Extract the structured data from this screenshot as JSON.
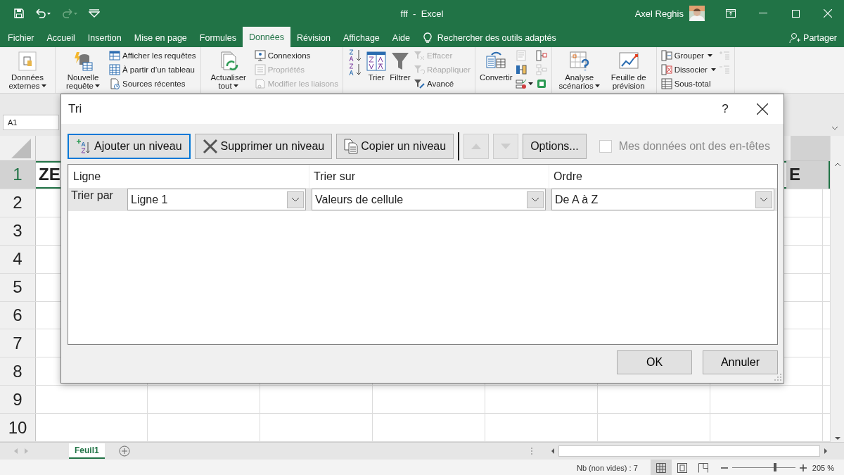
{
  "title_bar": {
    "title": "fff  -  Excel",
    "user": "Axel Reghis"
  },
  "menu_tabs": [
    {
      "label": "Fichier",
      "selected": false
    },
    {
      "label": "Accueil",
      "selected": false
    },
    {
      "label": "Insertion",
      "selected": false
    },
    {
      "label": "Mise en page",
      "selected": false
    },
    {
      "label": "Formules",
      "selected": false
    },
    {
      "label": "Données",
      "selected": true
    },
    {
      "label": "Révision",
      "selected": false
    },
    {
      "label": "Affichage",
      "selected": false
    },
    {
      "label": "Aide",
      "selected": false
    }
  ],
  "tell_me": "Rechercher des outils adaptés",
  "share": "Partager",
  "ribbon": {
    "groups": [
      {
        "columns": [
          [
            {
              "kind": "large",
              "label": "Données externes",
              "dropdown": true
            }
          ]
        ]
      },
      {
        "columns": [
          [
            {
              "kind": "large",
              "label": "Nouvelle requête",
              "dropdown": true
            }
          ],
          [
            {
              "kind": "small",
              "label": "Afficher les requêtes",
              "disabled": false
            },
            {
              "kind": "small",
              "label": "À partir d’un tableau",
              "disabled": false
            },
            {
              "kind": "small",
              "label": "Sources récentes",
              "disabled": false
            }
          ]
        ]
      },
      {
        "columns": [
          [
            {
              "kind": "large",
              "label": "Actualiser tout",
              "dropdown": true
            }
          ],
          [
            {
              "kind": "small",
              "label": "Connexions",
              "disabled": false
            },
            {
              "kind": "small",
              "label": "Propriétés",
              "disabled": true
            },
            {
              "kind": "small",
              "label": "Modifier les liaisons",
              "disabled": true
            }
          ]
        ]
      },
      {
        "columns": [
          [
            {
              "kind": "icon",
              "disabled": false
            },
            {
              "kind": "icon",
              "disabled": false
            }
          ],
          [
            {
              "kind": "large",
              "label": "Trier",
              "dropdown": false
            }
          ],
          [
            {
              "kind": "large",
              "label": "Filtrer",
              "dropdown": false
            }
          ],
          [
            {
              "kind": "small",
              "label": "Effacer",
              "disabled": true
            },
            {
              "kind": "small",
              "label": "Réappliquer",
              "disabled": true
            },
            {
              "kind": "small",
              "label": "Avancé",
              "disabled": false
            }
          ]
        ]
      },
      {
        "columns": [
          [
            {
              "kind": "large",
              "label": "Convertir",
              "dropdown": false
            }
          ],
          [
            {
              "kind": "icon",
              "disabled": true
            },
            {
              "kind": "icon",
              "disabled": false
            },
            {
              "kind": "icon",
              "disabled": false
            }
          ],
          [
            {
              "kind": "icon",
              "disabled": false
            },
            {
              "kind": "icon",
              "disabled": true
            },
            {
              "kind": "icon",
              "disabled": false
            }
          ]
        ]
      },
      {
        "columns": [
          [
            {
              "kind": "large",
              "label": "Analyse scénarios",
              "dropdown": true
            }
          ],
          [
            {
              "kind": "large",
              "label": "Feuille de prévision",
              "dropdown": false
            }
          ]
        ]
      },
      {
        "columns": [
          [
            {
              "kind": "small",
              "label": "Grouper",
              "disabled": false
            },
            {
              "kind": "small",
              "label": "Dissocier",
              "disabled": false
            },
            {
              "kind": "small",
              "label": "Sous-total",
              "disabled": false
            }
          ],
          [
            {
              "kind": "icon",
              "disabled": true
            },
            {
              "kind": "icon",
              "disabled": true
            }
          ]
        ]
      }
    ]
  },
  "name_box": "A1",
  "rows": [
    {
      "label": "1",
      "selected": true,
      "cells": [
        "ZE",
        "E"
      ]
    },
    {
      "label": "2",
      "selected": false
    },
    {
      "label": "3",
      "selected": false
    },
    {
      "label": "4",
      "selected": false
    },
    {
      "label": "5",
      "selected": false
    },
    {
      "label": "6",
      "selected": false
    },
    {
      "label": "7",
      "selected": false
    },
    {
      "label": "8",
      "selected": false
    },
    {
      "label": "9",
      "selected": false
    },
    {
      "label": "10",
      "selected": false
    }
  ],
  "sheet_tabs": [
    {
      "label": "Feuil1",
      "selected": true
    }
  ],
  "status_bar": {
    "summary": "Nb (non vides) : 7",
    "views": [
      {
        "selected": true
      },
      {
        "selected": false
      },
      {
        "selected": false
      }
    ],
    "zoom": {
      "level": 0.68,
      "reading": "205 %"
    }
  },
  "sort_dialog": {
    "title": "Tri",
    "help": "?",
    "toolbar": [
      {
        "kind": "add",
        "label": "Ajouter un niveau",
        "focused": true
      },
      {
        "kind": "delete",
        "label": "Supprimer un niveau",
        "focused": false
      },
      {
        "kind": "copy",
        "label": "Copier un niveau",
        "focused": false
      },
      {
        "kind": "up",
        "disabled": true
      },
      {
        "kind": "down",
        "disabled": true
      },
      {
        "kind": "text",
        "label": "Options...",
        "focused": false
      }
    ],
    "headers_checkbox": {
      "label": "Mes données ont des en-têtes",
      "checked": false,
      "disabled": true
    },
    "columns": [
      "Ligne",
      "Trier sur",
      "Ordre"
    ],
    "levels": [
      {
        "label": "Trier par",
        "selected": true,
        "values": [
          "Ligne 1",
          "Valeurs de cellule",
          "De A à Z"
        ]
      }
    ],
    "buttons": [
      "OK",
      "Annuler"
    ]
  }
}
